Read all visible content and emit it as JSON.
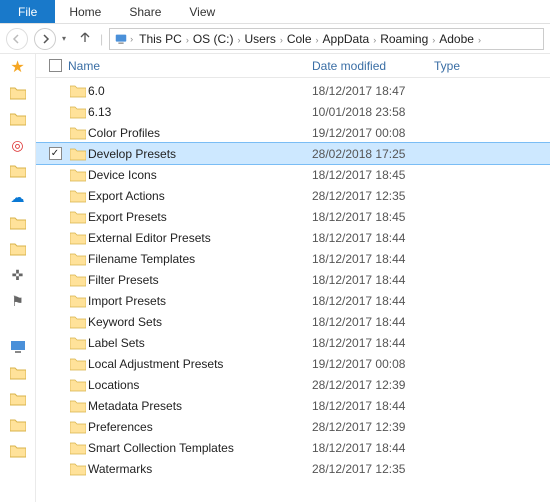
{
  "ribbon": {
    "file": "File",
    "home": "Home",
    "share": "Share",
    "view": "View"
  },
  "breadcrumb": [
    "This PC",
    "OS (C:)",
    "Users",
    "Cole",
    "AppData",
    "Roaming",
    "Adobe"
  ],
  "columns": {
    "name": "Name",
    "date": "Date modified",
    "type": "Type"
  },
  "selected_index": 3,
  "items": [
    {
      "name": "6.0",
      "date": "18/12/2017 18:47"
    },
    {
      "name": "6.13",
      "date": "10/01/2018 23:58"
    },
    {
      "name": "Color Profiles",
      "date": "19/12/2017 00:08"
    },
    {
      "name": "Develop Presets",
      "date": "28/02/2018 17:25"
    },
    {
      "name": "Device Icons",
      "date": "18/12/2017 18:45"
    },
    {
      "name": "Export Actions",
      "date": "28/12/2017 12:35"
    },
    {
      "name": "Export Presets",
      "date": "18/12/2017 18:45"
    },
    {
      "name": "External Editor Presets",
      "date": "18/12/2017 18:44"
    },
    {
      "name": "Filename Templates",
      "date": "18/12/2017 18:44"
    },
    {
      "name": "Filter Presets",
      "date": "18/12/2017 18:44"
    },
    {
      "name": "Import Presets",
      "date": "18/12/2017 18:44"
    },
    {
      "name": "Keyword Sets",
      "date": "18/12/2017 18:44"
    },
    {
      "name": "Label Sets",
      "date": "18/12/2017 18:44"
    },
    {
      "name": "Local Adjustment Presets",
      "date": "19/12/2017 00:08"
    },
    {
      "name": "Locations",
      "date": "28/12/2017 12:39"
    },
    {
      "name": "Metadata Presets",
      "date": "18/12/2017 18:44"
    },
    {
      "name": "Preferences",
      "date": "28/12/2017 12:39"
    },
    {
      "name": "Smart Collection Templates",
      "date": "18/12/2017 18:44"
    },
    {
      "name": "Watermarks",
      "date": "28/12/2017 12:35"
    }
  ]
}
